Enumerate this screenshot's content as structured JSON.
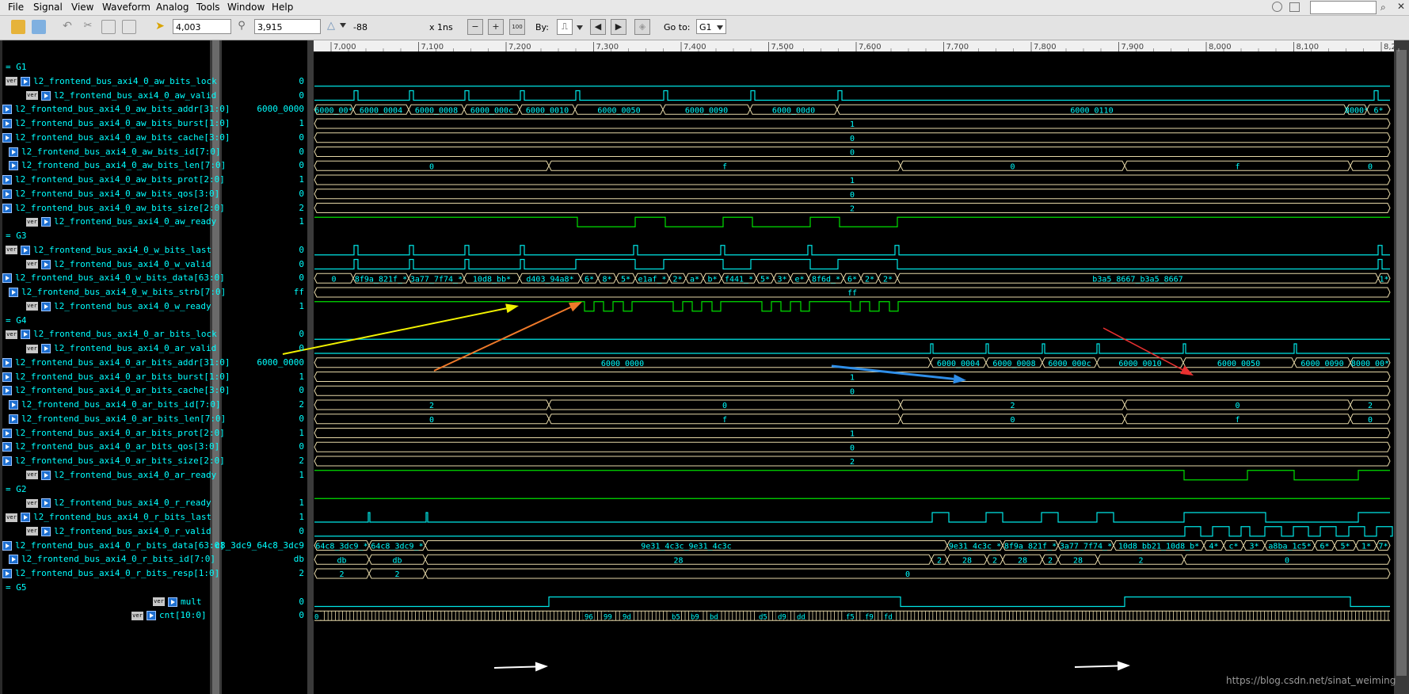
{
  "menu": [
    "File",
    "Signal",
    "View",
    "Waveform",
    "Analog",
    "Tools",
    "Window",
    "Help"
  ],
  "toolbar": {
    "cursor_time": "4,003",
    "marker_time": "3,915",
    "delta": "-88",
    "time_unit": "x 1ns",
    "by_label": "By:",
    "goto_label": "Go to:",
    "goto_value": "G1",
    "zoom_fit_label": "100"
  },
  "ruler": {
    "ticks": [
      "7,000",
      "7,100",
      "7,200",
      "7,300",
      "7,400",
      "7,500",
      "7,600",
      "7,700",
      "7,800",
      "7,900",
      "8,000",
      "8,100",
      "8,2"
    ]
  },
  "signals": [
    {
      "kind": "group",
      "label": "= G1"
    },
    {
      "kind": "sig",
      "name": "l2_frontend_bus_axi4_0_aw_bits_lock",
      "value": "0",
      "indent": "ver"
    },
    {
      "kind": "sig",
      "name": "l2_frontend_bus_axi4_0_aw_valid",
      "value": "0",
      "indent": "deep"
    },
    {
      "kind": "sig",
      "name": "l2_frontend_bus_axi4_0_aw_bits_addr[31:0]",
      "value": "6000_0000",
      "indent": "edge"
    },
    {
      "kind": "sig",
      "name": "l2_frontend_bus_axi4_0_aw_bits_burst[1:0]",
      "value": "1",
      "indent": "edge"
    },
    {
      "kind": "sig",
      "name": "l2_frontend_bus_axi4_0_aw_bits_cache[3:0]",
      "value": "0",
      "indent": "edge"
    },
    {
      "kind": "sig",
      "name": "l2_frontend_bus_axi4_0_aw_bits_id[7:0]",
      "value": "0",
      "indent": "mid"
    },
    {
      "kind": "sig",
      "name": "l2_frontend_bus_axi4_0_aw_bits_len[7:0]",
      "value": "0",
      "indent": "mid"
    },
    {
      "kind": "sig",
      "name": "l2_frontend_bus_axi4_0_aw_bits_prot[2:0]",
      "value": "1",
      "indent": "edge"
    },
    {
      "kind": "sig",
      "name": "l2_frontend_bus_axi4_0_aw_bits_qos[3:0]",
      "value": "0",
      "indent": "edge"
    },
    {
      "kind": "sig",
      "name": "l2_frontend_bus_axi4_0_aw_bits_size[2:0]",
      "value": "2",
      "indent": "edge"
    },
    {
      "kind": "sig",
      "name": "l2_frontend_bus_axi4_0_aw_ready",
      "value": "1",
      "indent": "deep"
    },
    {
      "kind": "group",
      "label": "= G3"
    },
    {
      "kind": "sig",
      "name": "l2_frontend_bus_axi4_0_w_bits_last",
      "value": "0",
      "indent": "ver"
    },
    {
      "kind": "sig",
      "name": "l2_frontend_bus_axi4_0_w_valid",
      "value": "0",
      "indent": "deep"
    },
    {
      "kind": "sig",
      "name": "l2_frontend_bus_axi4_0_w_bits_data[63:0]",
      "value": "0",
      "indent": "edge"
    },
    {
      "kind": "sig",
      "name": "l2_frontend_bus_axi4_0_w_bits_strb[7:0]",
      "value": "ff",
      "indent": "mid"
    },
    {
      "kind": "sig",
      "name": "l2_frontend_bus_axi4_0_w_ready",
      "value": "1",
      "indent": "deep"
    },
    {
      "kind": "group",
      "label": "= G4"
    },
    {
      "kind": "sig",
      "name": "l2_frontend_bus_axi4_0_ar_bits_lock",
      "value": "0",
      "indent": "ver"
    },
    {
      "kind": "sig",
      "name": "l2_frontend_bus_axi4_0_ar_valid",
      "value": "0",
      "indent": "deep"
    },
    {
      "kind": "sig",
      "name": "l2_frontend_bus_axi4_0_ar_bits_addr[31:0]",
      "value": "6000_0000",
      "indent": "edge"
    },
    {
      "kind": "sig",
      "name": "l2_frontend_bus_axi4_0_ar_bits_burst[1:0]",
      "value": "1",
      "indent": "edge"
    },
    {
      "kind": "sig",
      "name": "l2_frontend_bus_axi4_0_ar_bits_cache[3:0]",
      "value": "0",
      "indent": "edge"
    },
    {
      "kind": "sig",
      "name": "l2_frontend_bus_axi4_0_ar_bits_id[7:0]",
      "value": "2",
      "indent": "mid"
    },
    {
      "kind": "sig",
      "name": "l2_frontend_bus_axi4_0_ar_bits_len[7:0]",
      "value": "0",
      "indent": "mid"
    },
    {
      "kind": "sig",
      "name": "l2_frontend_bus_axi4_0_ar_bits_prot[2:0]",
      "value": "1",
      "indent": "edge"
    },
    {
      "kind": "sig",
      "name": "l2_frontend_bus_axi4_0_ar_bits_qos[3:0]",
      "value": "0",
      "indent": "edge"
    },
    {
      "kind": "sig",
      "name": "l2_frontend_bus_axi4_0_ar_bits_size[2:0]",
      "value": "2",
      "indent": "edge"
    },
    {
      "kind": "sig",
      "name": "l2_frontend_bus_axi4_0_ar_ready",
      "value": "1",
      "indent": "deep"
    },
    {
      "kind": "group",
      "label": "= G2"
    },
    {
      "kind": "sig",
      "name": "l2_frontend_bus_axi4_0_r_ready",
      "value": "1",
      "indent": "deep"
    },
    {
      "kind": "sig",
      "name": "l2_frontend_bus_axi4_0_r_bits_last",
      "value": "1",
      "indent": "ver"
    },
    {
      "kind": "sig",
      "name": "l2_frontend_bus_axi4_0_r_valid",
      "value": "0",
      "indent": "deep"
    },
    {
      "kind": "sig",
      "name": "l2_frontend_bus_axi4_0_r_bits_data[63:0]",
      "value": "c8_3dc9_64c8_3dc9",
      "indent": "edge"
    },
    {
      "kind": "sig",
      "name": "l2_frontend_bus_axi4_0_r_bits_id[7:0]",
      "value": "db",
      "indent": "mid"
    },
    {
      "kind": "sig",
      "name": "l2_frontend_bus_axi4_0_r_bits_resp[1:0]",
      "value": "2",
      "indent": "edge"
    },
    {
      "kind": "group",
      "label": "= G5"
    },
    {
      "kind": "sig",
      "name": "mult",
      "value": "0",
      "indent": "far"
    },
    {
      "kind": "sig",
      "name": "cnt[10:0]",
      "value": "0",
      "indent": "far2"
    }
  ],
  "waves": [
    {
      "kind": "none"
    },
    {
      "kind": "bit",
      "base": 0,
      "edges": []
    },
    {
      "kind": "bit",
      "base": 0,
      "edges": [
        447,
        452,
        517,
        522,
        587,
        592,
        657,
        662,
        727,
        732,
        838,
        843,
        948,
        953,
        1058,
        1063,
        1735,
        1740
      ]
    },
    {
      "kind": "bus",
      "segs": [
        [
          397,
          "6000_00*"
        ],
        [
          446,
          "6000_0004"
        ],
        [
          516,
          "6000_0008"
        ],
        [
          586,
          "6000_000c"
        ],
        [
          656,
          "6000_0010"
        ],
        [
          726,
          "6000_0050"
        ],
        [
          837,
          "6000_0090"
        ],
        [
          947,
          "6000_00d0"
        ],
        [
          1057,
          "6000_0110"
        ],
        [
          1700,
          "8000*"
        ],
        [
          1726,
          "6*"
        ],
        [
          1755,
          ""
        ]
      ]
    },
    {
      "kind": "bus",
      "segs": [
        [
          397,
          "1"
        ],
        [
          1755,
          ""
        ]
      ]
    },
    {
      "kind": "bus",
      "segs": [
        [
          397,
          "0"
        ],
        [
          1755,
          ""
        ]
      ]
    },
    {
      "kind": "bus",
      "segs": [
        [
          397,
          "0"
        ],
        [
          1755,
          ""
        ]
      ]
    },
    {
      "kind": "bus",
      "segs": [
        [
          397,
          "0"
        ],
        [
          693,
          "f"
        ],
        [
          1137,
          "0"
        ],
        [
          1420,
          "f"
        ],
        [
          1705,
          "0"
        ],
        [
          1755,
          ""
        ]
      ]
    },
    {
      "kind": "bus",
      "segs": [
        [
          397,
          "1"
        ],
        [
          1755,
          ""
        ]
      ]
    },
    {
      "kind": "bus",
      "segs": [
        [
          397,
          "0"
        ],
        [
          1755,
          ""
        ]
      ]
    },
    {
      "kind": "bus",
      "segs": [
        [
          397,
          "2"
        ],
        [
          1755,
          ""
        ]
      ]
    },
    {
      "kind": "bit",
      "base": 1,
      "edges": [
        729,
        802,
        840,
        913,
        950,
        1023,
        1060,
        1133
      ]
    },
    {
      "kind": "none"
    },
    {
      "kind": "bit",
      "base": 0,
      "edges": [
        447,
        452,
        517,
        522,
        587,
        592,
        657,
        662,
        800,
        805,
        910,
        915,
        1020,
        1025,
        1130,
        1135,
        1740,
        1745
      ]
    },
    {
      "kind": "bit",
      "base": 0,
      "edges": [
        447,
        452,
        517,
        522,
        587,
        592,
        657,
        662,
        727,
        802,
        838,
        913,
        948,
        1023,
        1058,
        1133,
        1740,
        1745
      ]
    },
    {
      "kind": "bus",
      "segs": [
        [
          397,
          "0"
        ],
        [
          446,
          "8f9a_821f_*"
        ],
        [
          516,
          "3a77_7f74_*"
        ],
        [
          586,
          "10d8_bb*"
        ],
        [
          656,
          "d403_94a8*"
        ],
        [
          733,
          "6*"
        ],
        [
          755,
          "8*"
        ],
        [
          778,
          "5*"
        ],
        [
          802,
          "e1af_*"
        ],
        [
          845,
          "2*"
        ],
        [
          866,
          "a*"
        ],
        [
          888,
          "b*"
        ],
        [
          911,
          "f441_*"
        ],
        [
          955,
          "5*"
        ],
        [
          977,
          "3*"
        ],
        [
          998,
          "e*"
        ],
        [
          1021,
          "8f6d_*"
        ],
        [
          1065,
          "6*"
        ],
        [
          1087,
          "2*"
        ],
        [
          1109,
          "2*"
        ],
        [
          1133,
          "b3a5_8667_b3a5_8667"
        ],
        [
          1740,
          "1*"
        ],
        [
          1755,
          ""
        ]
      ]
    },
    {
      "kind": "bus",
      "segs": [
        [
          397,
          "ff"
        ],
        [
          1755,
          ""
        ]
      ]
    },
    {
      "kind": "bit",
      "base": 1,
      "edges": [
        738,
        750,
        762,
        774,
        787,
        798,
        850,
        862,
        874,
        886,
        899,
        910,
        962,
        974,
        986,
        998,
        1011,
        1022,
        1074,
        1086,
        1098,
        1110,
        1123,
        1134
      ]
    },
    {
      "kind": "none"
    },
    {
      "kind": "bit",
      "base": 0,
      "edges": []
    },
    {
      "kind": "bit",
      "base": 0,
      "edges": [
        1175,
        1178,
        1245,
        1248,
        1316,
        1319,
        1385,
        1388,
        1494,
        1497,
        1634,
        1637
      ]
    },
    {
      "kind": "bus",
      "segs": [
        [
          397,
          "6000_0000"
        ],
        [
          1175,
          "6000_0004"
        ],
        [
          1245,
          "6000_0008"
        ],
        [
          1316,
          "6000_000c"
        ],
        [
          1385,
          "6000_0010"
        ],
        [
          1494,
          "6000_0050"
        ],
        [
          1634,
          "6000_0090"
        ],
        [
          1705,
          "8000_00*"
        ],
        [
          1755,
          ""
        ]
      ]
    },
    {
      "kind": "bus",
      "segs": [
        [
          397,
          "1"
        ],
        [
          1755,
          ""
        ]
      ]
    },
    {
      "kind": "bus",
      "segs": [
        [
          397,
          "0"
        ],
        [
          1755,
          ""
        ]
      ]
    },
    {
      "kind": "bus",
      "segs": [
        [
          397,
          "2"
        ],
        [
          693,
          "0"
        ],
        [
          1137,
          "2"
        ],
        [
          1420,
          "0"
        ],
        [
          1705,
          "2"
        ],
        [
          1755,
          ""
        ]
      ]
    },
    {
      "kind": "bus",
      "segs": [
        [
          397,
          "0"
        ],
        [
          693,
          "f"
        ],
        [
          1137,
          "0"
        ],
        [
          1420,
          "f"
        ],
        [
          1705,
          "0"
        ],
        [
          1755,
          ""
        ]
      ]
    },
    {
      "kind": "bus",
      "segs": [
        [
          397,
          "1"
        ],
        [
          1755,
          ""
        ]
      ]
    },
    {
      "kind": "bus",
      "segs": [
        [
          397,
          "0"
        ],
        [
          1755,
          ""
        ]
      ]
    },
    {
      "kind": "bus",
      "segs": [
        [
          397,
          "2"
        ],
        [
          1755,
          ""
        ]
      ]
    },
    {
      "kind": "bit",
      "base": 1,
      "edges": [
        1495,
        1575,
        1634,
        1715
      ]
    },
    {
      "kind": "none"
    },
    {
      "kind": "bit",
      "base": 1,
      "edges": []
    },
    {
      "kind": "bit",
      "base": 0,
      "edges": [
        465,
        467,
        538,
        540,
        1177,
        1198,
        1245,
        1266,
        1315,
        1336,
        1385,
        1406,
        1495,
        1598,
        1715
      ]
    },
    {
      "kind": "bit",
      "base": 0,
      "edges": [
        1496,
        1516,
        1531,
        1552,
        1567,
        1578,
        1597,
        1618,
        1633,
        1652,
        1667,
        1687,
        1703,
        1723,
        1738,
        1758
      ]
    },
    {
      "kind": "bus",
      "segs": [
        [
          397,
          "64c8_3dc9_*"
        ],
        [
          466,
          "64c8_3dc9_*"
        ],
        [
          537,
          "9e31_4c3c_9e31_4c3c"
        ],
        [
          1196,
          "9e31_4c3c_*"
        ],
        [
          1266,
          "8f9a_821f_*"
        ],
        [
          1336,
          "3a77_7f74_*"
        ],
        [
          1406,
          "10d8_bb21_10d8_b*"
        ],
        [
          1520,
          "4*"
        ],
        [
          1545,
          "c*"
        ],
        [
          1570,
          "3*"
        ],
        [
          1597,
          "a8ba_1c5*"
        ],
        [
          1660,
          "6*"
        ],
        [
          1685,
          "5*"
        ],
        [
          1712,
          "1*"
        ],
        [
          1738,
          "7*"
        ],
        [
          1755,
          ""
        ]
      ]
    },
    {
      "kind": "bus",
      "segs": [
        [
          397,
          "db"
        ],
        [
          466,
          "db"
        ],
        [
          537,
          "28"
        ],
        [
          1176,
          "2"
        ],
        [
          1196,
          "28"
        ],
        [
          1246,
          "2"
        ],
        [
          1266,
          "28"
        ],
        [
          1316,
          "2"
        ],
        [
          1336,
          "28"
        ],
        [
          1386,
          "2"
        ],
        [
          1495,
          "0"
        ],
        [
          1755,
          ""
        ]
      ]
    },
    {
      "kind": "bus",
      "segs": [
        [
          397,
          "2"
        ],
        [
          466,
          "2"
        ],
        [
          537,
          "0"
        ],
        [
          1755,
          ""
        ]
      ]
    },
    {
      "kind": "none"
    },
    {
      "kind": "bit",
      "base": 0,
      "edges": [
        693,
        1137,
        1420,
        1705
      ]
    },
    {
      "kind": "cnt",
      "labels": [
        [
          397,
          "0"
        ],
        [
          738,
          "96"
        ],
        [
          762,
          "99"
        ],
        [
          786,
          "9d"
        ],
        [
          848,
          "b5"
        ],
        [
          872,
          "b9"
        ],
        [
          896,
          "bd"
        ],
        [
          958,
          "d5"
        ],
        [
          982,
          "d9"
        ],
        [
          1006,
          "dd"
        ],
        [
          1068,
          "f5"
        ],
        [
          1092,
          "f9"
        ],
        [
          1116,
          "fd"
        ]
      ]
    }
  ],
  "watermark": "https://blog.csdn.net/sinat_weiming",
  "colors": {
    "bus": "#e6d8a8",
    "bit": "#00e5e5",
    "ready": "#00e000",
    "text": "#00ffff"
  }
}
